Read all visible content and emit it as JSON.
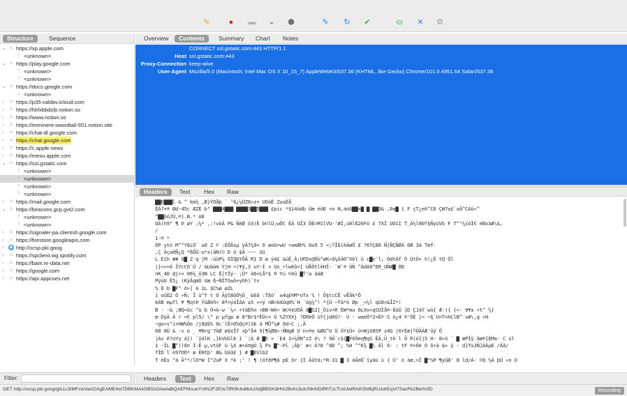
{
  "toolbar": {
    "icons": [
      {
        "name": "broom-icon",
        "glyph": "✎",
        "color": "#f0a020"
      },
      {
        "name": "record-icon",
        "glyph": "●",
        "color": "#e8203a"
      },
      {
        "name": "throttle-icon",
        "glyph": "▬",
        "color": "#b0b0b0"
      },
      {
        "name": "turtle-icon",
        "glyph": "◒",
        "color": "#909090"
      },
      {
        "name": "breakpoint-icon",
        "glyph": "⬢",
        "color": "#707070"
      },
      {
        "name": "pen-icon",
        "glyph": "✎",
        "color": "#1e88f0"
      },
      {
        "name": "refresh-icon",
        "glyph": "↻",
        "color": "#1e88f0"
      },
      {
        "name": "check-icon",
        "glyph": "✔",
        "color": "#2fb040"
      },
      {
        "name": "basket-icon",
        "glyph": "⛀",
        "color": "#2fb040"
      },
      {
        "name": "tools-icon",
        "glyph": "✕",
        "color": "#3a80e0"
      },
      {
        "name": "settings-gear-icon",
        "glyph": "⚙",
        "color": "#9a9a9a"
      }
    ]
  },
  "left_tabs": {
    "structure": "Structure",
    "sequence": "Sequence"
  },
  "right_tabs": {
    "overview": "Overview",
    "contents": "Contents",
    "summary": "Summary",
    "chart": "Chart",
    "notes": "Notes"
  },
  "tree": [
    {
      "indent": 0,
      "chev": "⌄",
      "icon": "lock",
      "label": "https://xp.apple.com"
    },
    {
      "indent": 1,
      "chev": "",
      "icon": "up",
      "label": "<unknown>"
    },
    {
      "indent": 0,
      "chev": "⌄",
      "icon": "lock",
      "label": "https://play.google.com"
    },
    {
      "indent": 1,
      "chev": "",
      "icon": "up",
      "label": "<unknown>"
    },
    {
      "indent": 1,
      "chev": "",
      "icon": "up",
      "label": "<unknown>"
    },
    {
      "indent": 0,
      "chev": "⌄",
      "icon": "lock",
      "label": "https://docs.google.com"
    },
    {
      "indent": 1,
      "chev": "",
      "icon": "down",
      "label": "<unknown>"
    },
    {
      "indent": 0,
      "chev": "›",
      "icon": "lock",
      "label": "https://p35-caldav.icloud.com"
    },
    {
      "indent": 0,
      "chev": "›",
      "icon": "lock",
      "label": "https://hkfxbbdzib.notion.so"
    },
    {
      "indent": 0,
      "chev": "›",
      "icon": "lock",
      "label": "https://www.notion.so"
    },
    {
      "indent": 0,
      "chev": "›",
      "icon": "lock",
      "label": "https://imminent-swordtail-551.notion.site"
    },
    {
      "indent": 0,
      "chev": "›",
      "icon": "lock",
      "label": "https://chat-dl.google.com"
    },
    {
      "indent": 0,
      "chev": "›",
      "icon": "lock",
      "label": "https://chat.google.com",
      "highlight": true
    },
    {
      "indent": 0,
      "chev": "›",
      "icon": "lock",
      "label": "https://c.apple.news"
    },
    {
      "indent": 0,
      "chev": "›",
      "icon": "lock",
      "label": "https://mesu.apple.com"
    },
    {
      "indent": 0,
      "chev": "⌄",
      "icon": "lock",
      "label": "https://ssl.gstatic.com"
    },
    {
      "indent": 1,
      "chev": "",
      "icon": "up",
      "label": "<unknown>"
    },
    {
      "indent": 1,
      "chev": "",
      "icon": "up",
      "label": "<unknown>",
      "selected": true
    },
    {
      "indent": 1,
      "chev": "",
      "icon": "up",
      "label": "<unknown>"
    },
    {
      "indent": 1,
      "chev": "",
      "icon": "up",
      "label": "<unknown>"
    },
    {
      "indent": 0,
      "chev": "›",
      "icon": "lock",
      "label": "https://mail.google.com"
    },
    {
      "indent": 0,
      "chev": "⌄",
      "icon": "lock",
      "label": "https://beacons.gcp.gvt2.com"
    },
    {
      "indent": 1,
      "chev": "",
      "icon": "up",
      "label": "<unknown>"
    },
    {
      "indent": 1,
      "chev": "",
      "icon": "up",
      "label": "<unknown>"
    },
    {
      "indent": 0,
      "chev": "›",
      "icon": "lock",
      "label": "https://signaler-pa.clients6.google.com"
    },
    {
      "indent": 0,
      "chev": "›",
      "icon": "lock",
      "label": "https://firestore.googleapis.com"
    },
    {
      "indent": 0,
      "chev": "›",
      "icon": "globe",
      "label": "http://ocsp.pki.goog"
    },
    {
      "indent": 0,
      "chev": "›",
      "icon": "lock",
      "label": "https://spclient.wg.spotify.com"
    },
    {
      "indent": 0,
      "chev": "›",
      "icon": "lock",
      "label": "https://bam.nr-data.net"
    },
    {
      "indent": 0,
      "chev": "›",
      "icon": "lock",
      "label": "https://google.com"
    },
    {
      "indent": 0,
      "chev": "›",
      "icon": "lock",
      "label": "https://api.appcues.net"
    }
  ],
  "request": [
    {
      "key": "",
      "value": "CONNECT ssl.gstatic.com:443 HTTP/1.1"
    },
    {
      "key": "Host",
      "value": "ssl.gstatic.com:443"
    },
    {
      "key": "Proxy-Connection",
      "value": "keep-alive"
    },
    {
      "key": "User-Agent",
      "value": "Mozilla/5.0 (Macintosh; Intel Mac OS X 10_15_7) AppleWebKit/537.36 (KHTML, like Gecko) Chrome/101.0.4951.64 Safari/537.36"
    }
  ],
  "response_tabs": {
    "headers": "Headers",
    "text": "Text",
    "hex": "Hex",
    "raw": "Raw"
  },
  "body_lines": [
    "  ▇▇E▇▇▇l & ^ km¾ ,B}ÝOåþ ` ¹ß¿¼ÜZ8»z¤  UOäÈ Z±±Èå",
    "ÊÄ?+® Ød·45c  ÆZÈ b\" ▇▇▇4▇▇▇ ▇▇▇▇3▇▇5▇▇▇ £pic *$î4ödb Ùæ éûÐ ÷o N,áóG▇▇+▇  ▇ ▇▇D& ,Þ±▇  ï F çT¿eñ^C6 ÇW7±£`aå^CAü«^",
    "°▇▇òóJÜ,®).B.* A8",
    "OÀ(h9\" ¶   Þ øY ;¼*     ,:!vòÀ P& ÑëØ ö3)È b©lÜ;wÖC ÈÀ GÏ3 ÖÈ=RSlVU·'#Í,ú0lß26Fö  £  7XÍ UOïI T_À½l80f§ÑyüVb F    T°\"¼ïóÌ€ éBxä#\\&,",
    "/",
    "1-® *",
    "ðP ytò  M^°Y8iO` ±0 Z © :ÉÖÃsµ ÿÄ7¼9+ ð øoU>wU ÷±mÆh% 0±9  5 <;ºÎß(èÁøÕ £  ?6ÝÇ88  Ñ[ÑÇÑØÀ 0Ø  3à Tæf·",
    " ,Ç  ÃçaêÑ¿Q *ßÕÜ-u*x(âN(©  D  ö $Ã  ⸺ 3ü",
    " L  Eîh   ## ö▇ Z·q  jM  :üüP¼ ðÏQþYÕÄ  R1  D  ø  ý4£  &üÊ_Ã;UFDx@Öù°øK÷â¼ôâ0^Xèl  û  c▇v`l;  ÓdtÀf    Ò  ÙtÒ× h!¿Ë  tQ Ól",
    " |}<»+Á  ÏÝcCO`Ú  / &Uàòm Ý|H ÷(¥ý,3 uY·Í ¤  Ux_÷lwëô=[  ÚÅÓtlèHÎ·  `W`®  ÚÑ ^ÀdA0°ER_UÑ#▇  ðÐ",
    "nK_40   @j÷× 06½_ö3N  LC  ß]tÎý·  ;Û* à6+LÅ*§     Þ     Yú  ©èû  ▇º'a  äáÆ",
    " PÿüU Ê5¿    (KÿÂqmÚ  Uæ ß~ÑÏTõ±À+yhh)`tv",
    " %  ß  b   ▇F°  ö>] A  1L $C%ø     øZL",
    " î   oûß2 Ò »Ñ;  Î  ù^f  t O       ÃÿS8ôÒ½Ó_  &6ã :Tßö`  ±4q£®M*oTx % !  Ô§tcCÊ        vÊåk*Ô",
    "    kêB  mµfl  ¥  ¶qtÞ  ÝûÆèñ< 8ª=ýáÎÀA ±5 «<ý  nB=öAÚq0%`H   ¨ög¼^!  *{Ü ~Tà*ö  Øp _<¼l qû8>&ÎZ*!",
    " B ·  -&  ;ØQ<óc ^ù  b  Ò¤A-w  `¼< ÷täÈñn  ÷ÐB-Wé<  Wc®¢UÓÂ    ä▇S2[_Òiv÷R  ÈW*mu  6LXo<qSÜÌå®-ßûÜ  ]D ÇJáÝ wù{  Æ-){  {<-   9¥±  ÷t^  ½}",
    " æ DýÀ Ä  r   <€  pl5/  \\° p-µfgp      æ 8\"Br$*ËÜ<+ Ú     %ZYXXj  ?ÈRèÒ ùÝ{jdéÚ?· Ú  - waeÓ*2¤ßY·S  ó¿4  ®'ÖÈ }< ¬§`U=T=hClB^  x#\\,g »H",
    " ~go>s°í+HW%Õe /j6@$%  8c`lÊ+O%Qç®)3k ä MÔ°¼#   ðd~C  ;,Ä",
    "68     8Ü  & ·v  o  _      ¥Nrg'7ÁØ  ø$¢Íf xþ°å4    9[¶¼Ø8>·ÑNgÆ  U  n«®o  &ÆG^U  Ü       ôÝ¢Ü>    ü÷Wj£8S¥ z4G   |0rÉæ|ºÖÃÀÆ'ûÿ Ô",
    "|Av  ê?oYy á}) `ÿálK  ,}kVUûlk î  `¦À Æ ▇E  × `E4   1÷¼ÕN°zZ  è\\  ?  9Â`c${▇ÝêÖeq¶qS  ÉÁ,Ü_të  l Õ   R(óîj5 H- 8>ó     `  ▇ æPÏÿ    ãæ®]ÉMa·   C úl",
    "1 ·ÎL  ▇°))ðn Ï-Ë µ,vtöF  ù  ¼X  æ÷óπgÜ  ¾   Px  ▇°-Þl ;Áþ'      æ<  Ã?8 ^4D  ^;  %H ^°K¾  ▇\\ Ãl    ð·  : tF  ®÷Òè  Ò ô÷à &>    ý   - d}TxJÑ]ÀÀµE   /Áã/",
    "fÍD l`è97OÓ* ø   ÈNtþ'    Æ&     Ùá3£       }   #   ▇EVlb2",
    "T  ëÈs  °à  Ã°*/lO*W  Ì\"2uP X *k  ;' !  ¶     (öfêP¶â pE  Xr     {Í ÃûYá¡*R·31   ▇ 3 áÂeÈ`îyäú   ú {  Ú' ò  àæ,=Î  ▇\"%P       ¶yÚÆ' 8   ld/Á· ©Q ½À þÜ «n O"
  ],
  "filter": {
    "label": "Filter:",
    "value": ""
  },
  "bottom_tabs": {
    "headers": "Headers",
    "text": "Text",
    "hex": "Hex",
    "raw": "Raw"
  },
  "status": {
    "url": "GET http://ocsp.pki.goog/gts1c3/MFcwVaADAgEAME4wTDBKMAkGBSsOAwIaBQAEFMcueYrd%2F2E0s7tR0K4u8bAJAdjBBSKdH%2Bvhc3ulc09nNDiRhTzcTUdJwlRAKSNfkjRUzdrEqVi7Sacf%2Bw%3D",
    "recording": "Recording"
  },
  "colors": {
    "accent_blue": "#1a6fe6",
    "highlight_yellow": "#fff36b",
    "selected_gray": "#d8d8d8"
  }
}
